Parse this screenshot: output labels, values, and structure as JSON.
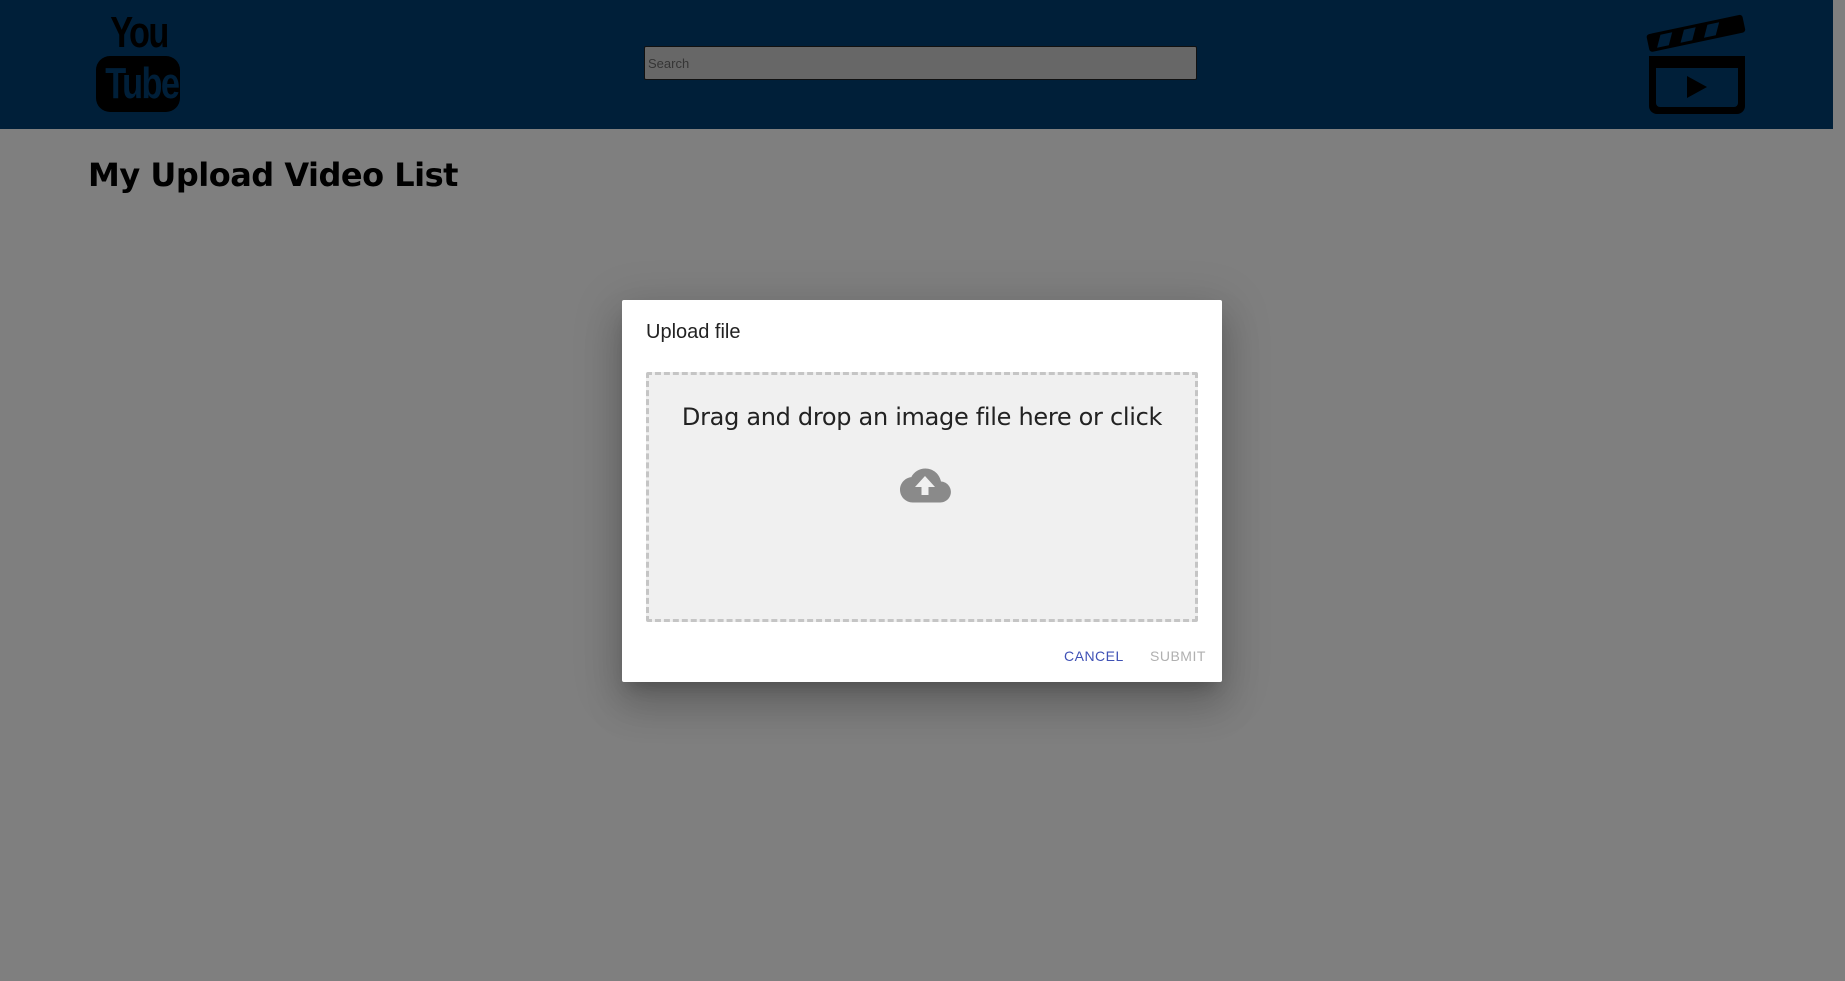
{
  "header": {
    "logo": {
      "line1": "You",
      "line2": "Tube"
    },
    "search": {
      "placeholder": "Search",
      "value": ""
    },
    "clapper_icon": "clapperboard-play-icon",
    "background_color": "#003f72"
  },
  "main": {
    "title": "My Upload Video List"
  },
  "dialog": {
    "title": "Upload file",
    "dropzone": {
      "text": "Drag and drop an image file here or click",
      "icon": "cloud-upload-icon"
    },
    "actions": {
      "cancel_label": "CANCEL",
      "submit_label": "SUBMIT",
      "cancel_color": "#3f51b5",
      "submit_disabled": true
    }
  }
}
